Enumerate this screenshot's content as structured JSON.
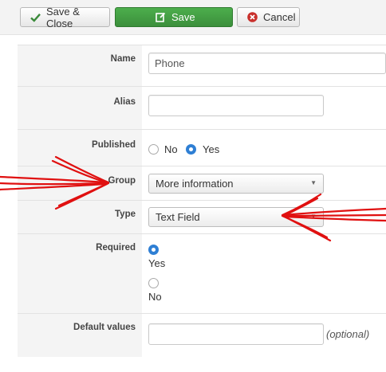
{
  "toolbar": {
    "save_close_label": "Save & Close",
    "save_label": "Save",
    "cancel_label": "Cancel"
  },
  "form": {
    "name": {
      "label": "Name",
      "value": "Phone"
    },
    "alias": {
      "label": "Alias",
      "value": ""
    },
    "published": {
      "label": "Published",
      "options": [
        "No",
        "Yes"
      ],
      "selected": "Yes"
    },
    "group": {
      "label": "Group",
      "value": "More information"
    },
    "type": {
      "label": "Type",
      "value": "Text Field"
    },
    "required": {
      "label": "Required",
      "options": [
        "Yes",
        "No"
      ],
      "selected": "Yes"
    },
    "default_values": {
      "label": "Default values",
      "value": "",
      "hint": "(optional)"
    }
  },
  "colors": {
    "save_green": "#3c9a3c",
    "radio_blue": "#2f7fd4",
    "annotation_red": "#e01010"
  },
  "icons": [
    "check-icon",
    "edit-icon",
    "cancel-icon",
    "chevron-down-icon"
  ]
}
